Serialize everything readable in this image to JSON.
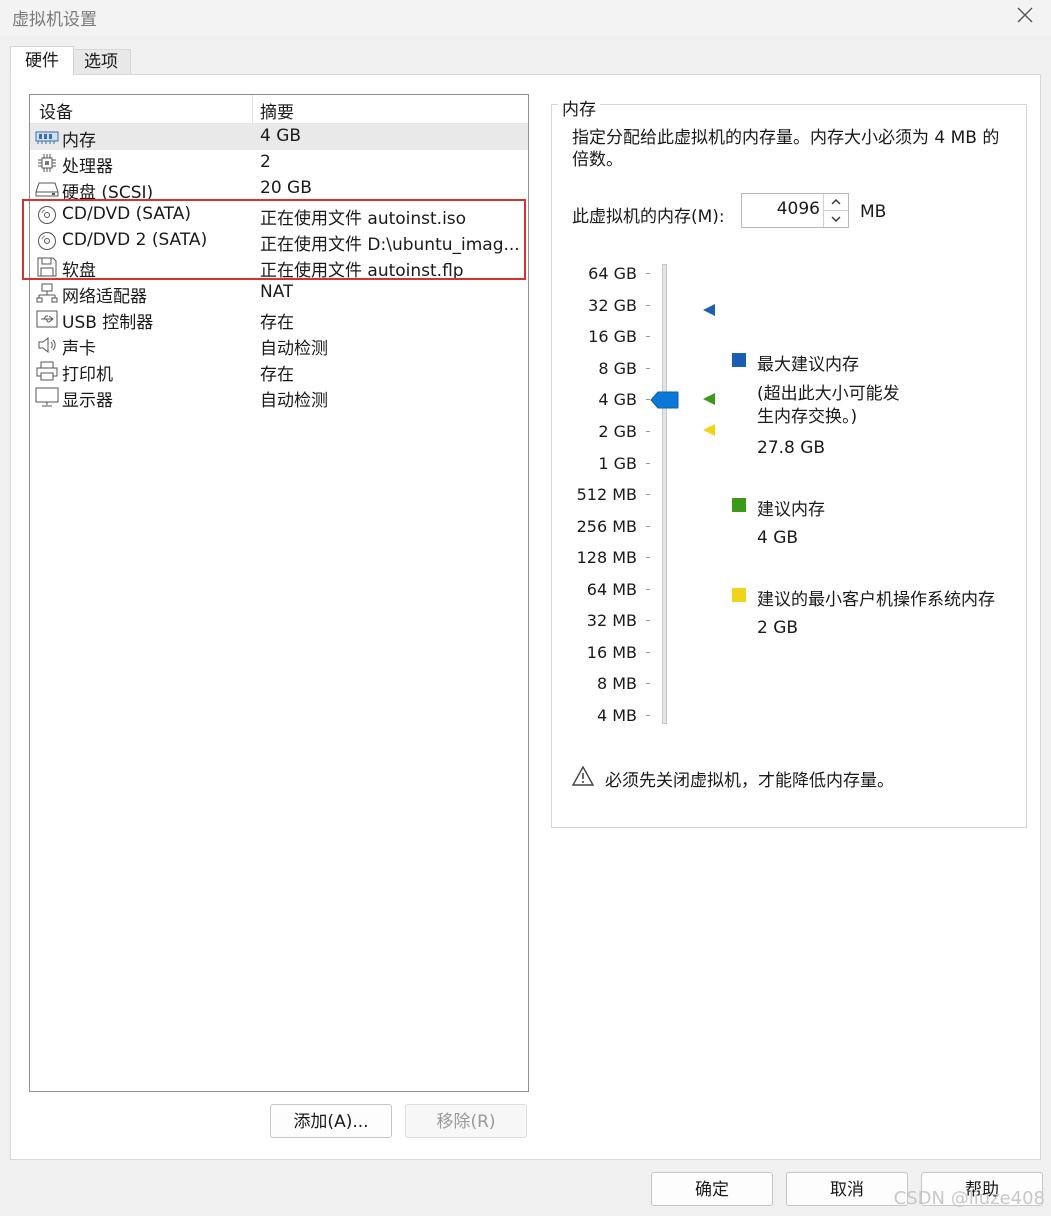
{
  "window": {
    "title": "虚拟机设置"
  },
  "tabs": [
    {
      "label": "硬件",
      "active": true
    },
    {
      "label": "选项",
      "active": false
    }
  ],
  "device_list": {
    "headers": {
      "device": "设备",
      "summary": "摘要"
    },
    "rows": [
      {
        "icon": "memory-icon",
        "name": "内存",
        "summary": "4 GB",
        "selected": true
      },
      {
        "icon": "processor-icon",
        "name": "处理器",
        "summary": "2"
      },
      {
        "icon": "hard-disk-icon",
        "name": "硬盘 (SCSI)",
        "summary": "20 GB"
      },
      {
        "icon": "cd-dvd-icon",
        "name": "CD/DVD (SATA)",
        "summary": "正在使用文件 autoinst.iso"
      },
      {
        "icon": "cd-dvd-icon",
        "name": "CD/DVD 2 (SATA)",
        "summary": "正在使用文件 D:\\ubuntu_imag..."
      },
      {
        "icon": "floppy-icon",
        "name": "软盘",
        "summary": "正在使用文件 autoinst.flp"
      },
      {
        "icon": "network-adapter-icon",
        "name": "网络适配器",
        "summary": "NAT"
      },
      {
        "icon": "usb-icon",
        "name": "USB 控制器",
        "summary": "存在"
      },
      {
        "icon": "sound-icon",
        "name": "声卡",
        "summary": "自动检测"
      },
      {
        "icon": "printer-icon",
        "name": "打印机",
        "summary": "存在"
      },
      {
        "icon": "display-icon",
        "name": "显示器",
        "summary": "自动检测"
      }
    ]
  },
  "list_buttons": {
    "add": "添加(A)...",
    "remove": "移除(R)"
  },
  "memory": {
    "group_title": "内存",
    "description": "指定分配给此虚拟机的内存量。内存大小必须为 4 MB 的倍数。",
    "field_label": "此虚拟机的内存(M):",
    "value": "4096",
    "unit": "MB",
    "scale_labels": [
      "64 GB",
      "32 GB",
      "16 GB",
      "8 GB",
      "4 GB",
      "2 GB",
      "1 GB",
      "512 MB",
      "256 MB",
      "128 MB",
      "64 MB",
      "32 MB",
      "16 MB",
      "8 MB",
      "4 MB"
    ],
    "slider_value": "4 GB",
    "legend": {
      "max_recommended": {
        "label": "最大建议内存",
        "note": "(超出此大小可能发生内存交换。)",
        "value": "27.8 GB",
        "color": "#1a5fb4"
      },
      "recommended": {
        "label": "建议内存",
        "value": "4 GB",
        "color": "#3a9b1a"
      },
      "min_recommended": {
        "label": "建议的最小客户机操作系统内存",
        "value": "2 GB",
        "color": "#f2d31b"
      }
    },
    "warning": "必须先关闭虚拟机，才能降低内存量。"
  },
  "footer_buttons": {
    "ok": "确定",
    "cancel": "取消",
    "help": "帮助"
  },
  "watermark": "CSDN @liuze408"
}
